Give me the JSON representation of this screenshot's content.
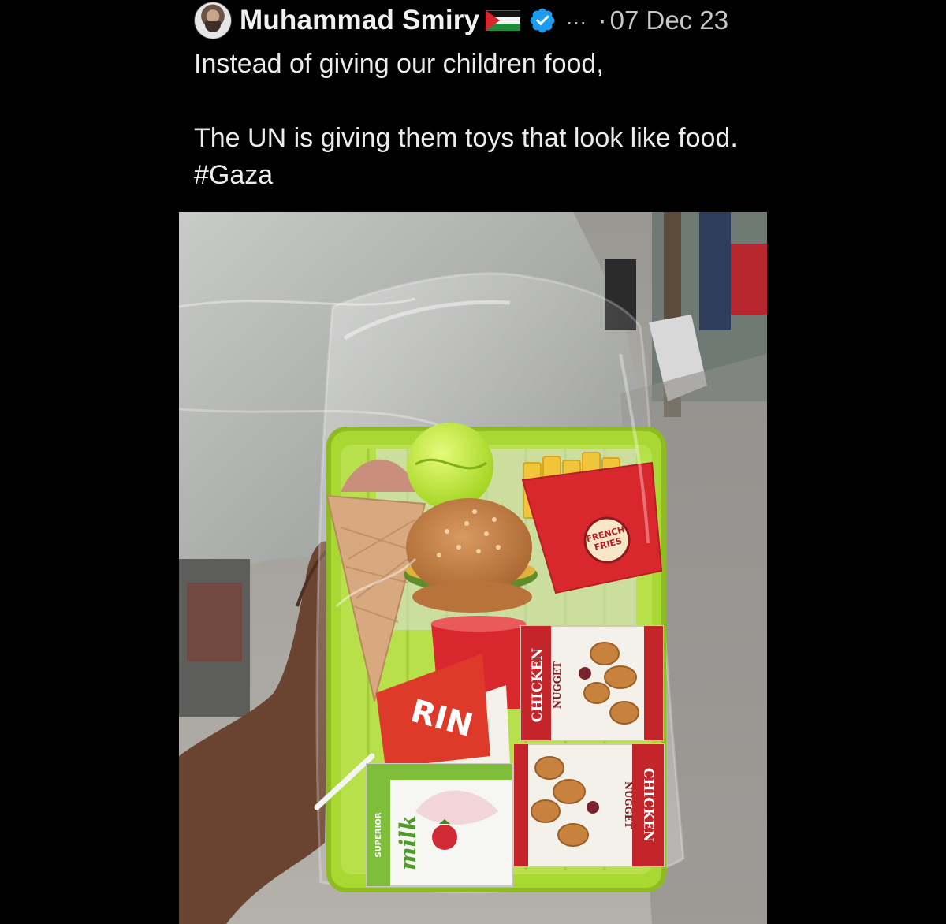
{
  "tweet": {
    "author_name": "Muhammad Smiry",
    "more_label": "...",
    "separator": "·",
    "timestamp": "07 Dec 23",
    "text_line1": "Instead of giving our children food,",
    "text_line2_prefix": "The UN is giving them toys that look like food. ",
    "hashtag": "#Gaza"
  },
  "media": {
    "fries_label_1": "FRENCH",
    "fries_label_2": "FRIES",
    "nugget_box_1_title": "CHICKEN",
    "nugget_box_1_sub": "NUGGET",
    "nugget_box_2_title": "CHICKEN",
    "nugget_box_2_sub": "NUGGET",
    "cup_text": "RIN",
    "milk_word": "milk",
    "milk_brand": "SUPERIOR"
  },
  "colors": {
    "background": "#000000",
    "text": "#e7e9ea",
    "verified_badge": "#1d9bf0",
    "tray_green": "#a9d833",
    "toy_red": "#d9272e"
  },
  "icons": {
    "verified": "verified-badge-icon",
    "more": "more-dots-icon",
    "flag": "palestine-flag-icon"
  }
}
